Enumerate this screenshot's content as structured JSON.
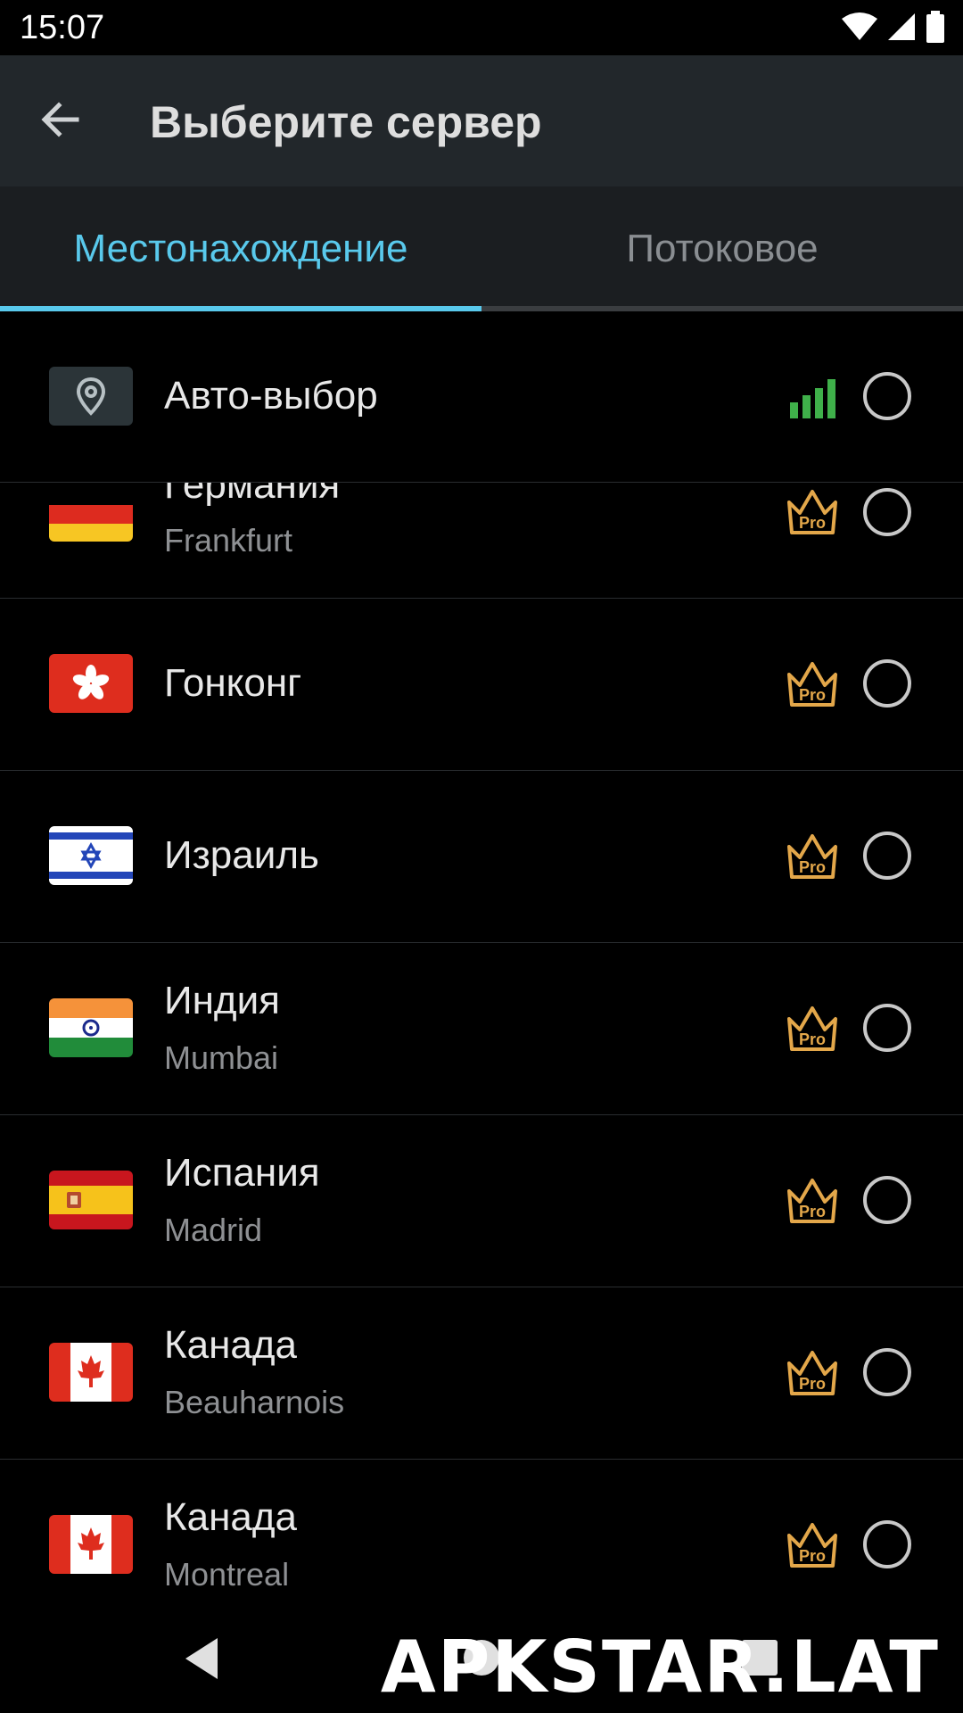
{
  "status_bar": {
    "time": "15:07",
    "icons": [
      "wifi-icon",
      "cell-signal-icon",
      "battery-icon"
    ]
  },
  "appbar": {
    "back_icon": "arrow-back-icon",
    "title": "Выберите сервер"
  },
  "tabs": [
    {
      "label": "Местонахождение",
      "selected": true
    },
    {
      "label": "Потоковое",
      "selected": false
    }
  ],
  "colors": {
    "accent": "#59c9ec",
    "pro_gold": "#e3a74a",
    "signal_green": "#3fb04a",
    "appbar_bg": "#22272b",
    "tabs_bg": "#1b1e21"
  },
  "servers": [
    {
      "country": "Авто-выбор",
      "city": "",
      "flag": "location-pin-icon",
      "badge": "signal-strength-icon"
    },
    {
      "country": "Германия",
      "city": "Frankfurt",
      "flag": "germany-flag",
      "badge": "pro-crown-icon",
      "badge_text": "Pro"
    },
    {
      "country": "Гонконг",
      "city": "",
      "flag": "hong-kong-flag",
      "badge": "pro-crown-icon",
      "badge_text": "Pro"
    },
    {
      "country": "Израиль",
      "city": "",
      "flag": "israel-flag",
      "badge": "pro-crown-icon",
      "badge_text": "Pro"
    },
    {
      "country": "Индия",
      "city": "Mumbai",
      "flag": "india-flag",
      "badge": "pro-crown-icon",
      "badge_text": "Pro"
    },
    {
      "country": "Испания",
      "city": "Madrid",
      "flag": "spain-flag",
      "badge": "pro-crown-icon",
      "badge_text": "Pro"
    },
    {
      "country": "Канада",
      "city": "Beauharnois",
      "flag": "canada-flag",
      "badge": "pro-crown-icon",
      "badge_text": "Pro"
    },
    {
      "country": "Канада",
      "city": "Montreal",
      "flag": "canada-flag",
      "badge": "pro-crown-icon",
      "badge_text": "Pro"
    }
  ],
  "nav_bar": {
    "icons": [
      "nav-back-icon",
      "nav-home-icon",
      "nav-recents-icon"
    ]
  },
  "watermark": "APKSTAR.LAT"
}
